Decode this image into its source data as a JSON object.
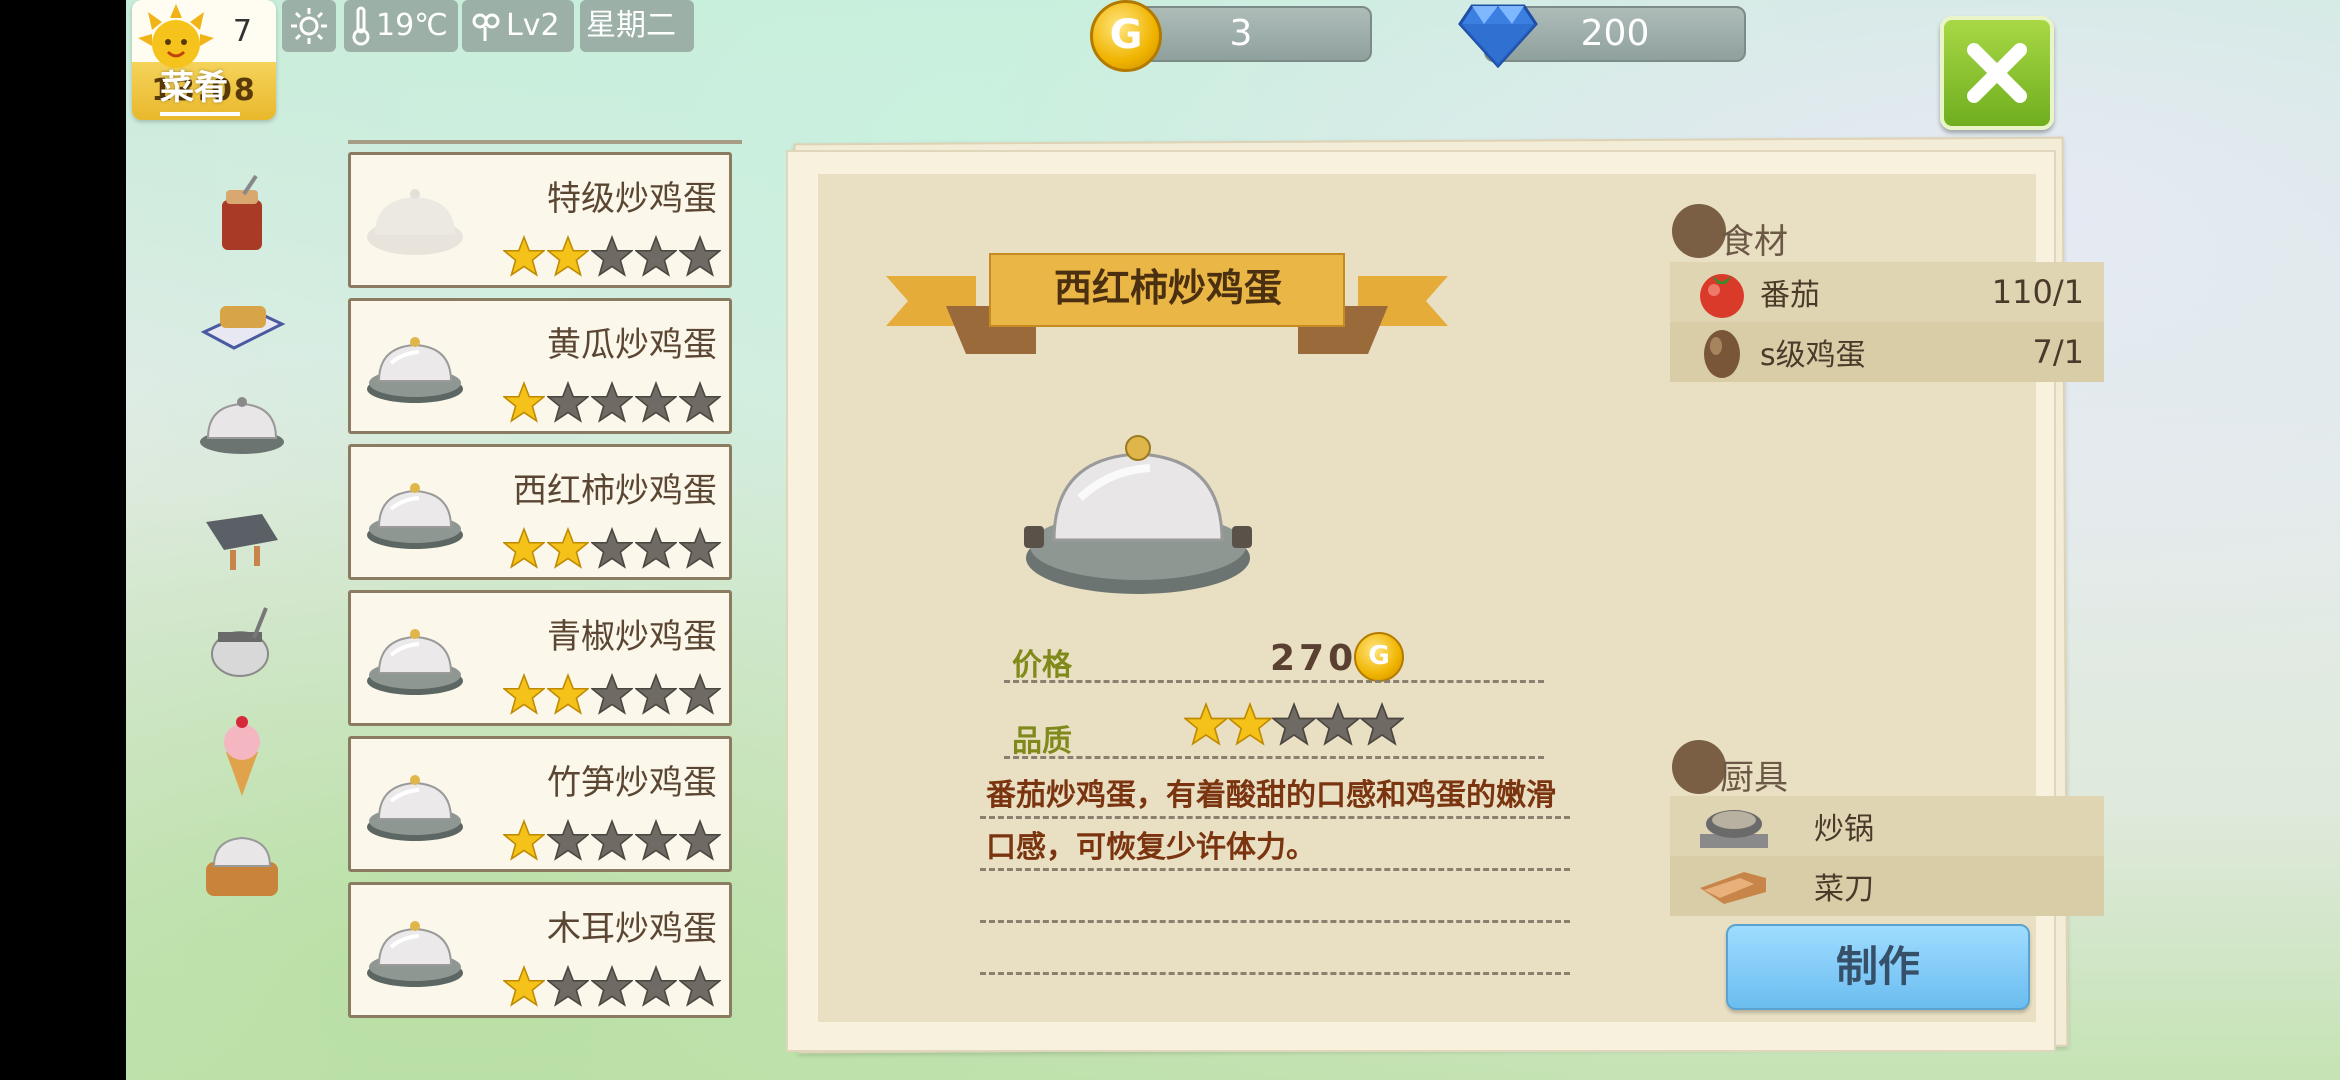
{
  "status": {
    "day": "7",
    "time": "13:08",
    "temperature": "19℃",
    "level": "Lv2",
    "weekday": "星期二"
  },
  "tab": {
    "label": "菜肴"
  },
  "currency": {
    "gold": "3",
    "diamond": "200",
    "coin_letter": "G"
  },
  "categories": [
    "drink-jar-icon",
    "tray-box-icon",
    "covered-dish-icon",
    "grill-plate-icon",
    "tea-pot-icon",
    "ice-cream-icon",
    "steamer-box-icon"
  ],
  "recipes": [
    {
      "name": "特级炒鸡蛋",
      "stars": 2,
      "locked": true
    },
    {
      "name": "黄瓜炒鸡蛋",
      "stars": 1,
      "locked": false
    },
    {
      "name": "西红柿炒鸡蛋",
      "stars": 2,
      "locked": false
    },
    {
      "name": "青椒炒鸡蛋",
      "stars": 2,
      "locked": false
    },
    {
      "name": "竹笋炒鸡蛋",
      "stars": 1,
      "locked": false
    },
    {
      "name": "木耳炒鸡蛋",
      "stars": 1,
      "locked": false
    }
  ],
  "detail": {
    "title": "西红柿炒鸡蛋",
    "price_label": "价格",
    "price": "270",
    "quality_label": "品质",
    "quality_stars": 2,
    "description": "番茄炒鸡蛋，有着酸甜的口感和鸡蛋的嫩滑口感，可恢复少许体力。",
    "ingredients_label": "食材",
    "ingredients": [
      {
        "name": "番茄",
        "qty": "110/1",
        "icon": "tomato-icon"
      },
      {
        "name": "s级鸡蛋",
        "qty": "7/1",
        "icon": "egg-icon"
      }
    ],
    "tools_label": "厨具",
    "tools": [
      {
        "name": "炒锅",
        "icon": "wok-icon"
      },
      {
        "name": "菜刀",
        "icon": "knife-icon"
      }
    ],
    "make_label": "制作"
  },
  "colors": {
    "star_gold": "#f5c21a",
    "star_gray": "#6f6a63",
    "make_button": "#7cc8f4",
    "close_button": "#8cc83a"
  }
}
